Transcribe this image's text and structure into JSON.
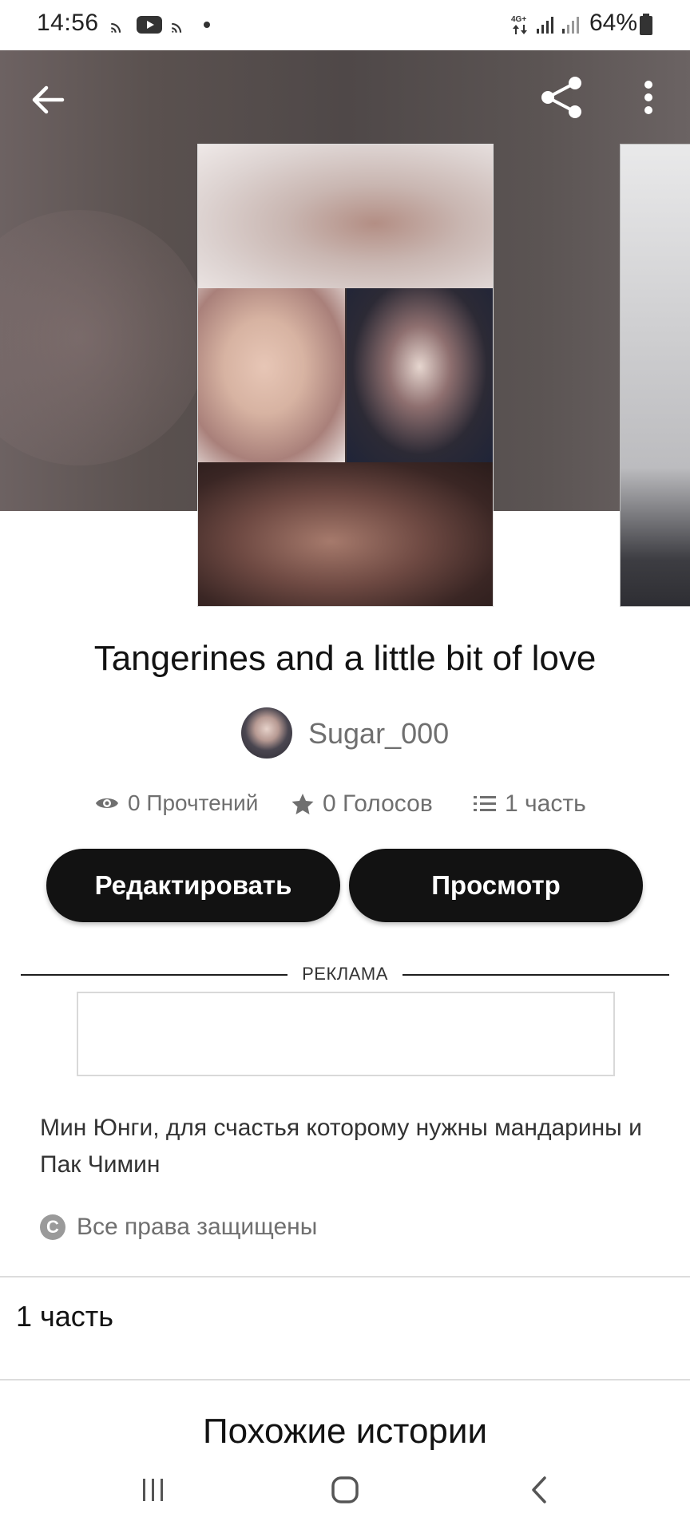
{
  "status_bar": {
    "time": "14:56",
    "battery": "64%",
    "network": "4G+"
  },
  "header": {
    "back_icon": "arrow-left-icon",
    "share_icon": "share-icon",
    "more_icon": "more-vertical-icon"
  },
  "story": {
    "title": "Tangerines and a little bit of love",
    "author": "Sugar_000",
    "stats": {
      "reads": "0 Прочтений",
      "votes": "0 Голосов",
      "parts": "1 часть"
    },
    "description": "Мин Юнги, для счастья которому нужны мандарины и Пак Чимин",
    "copyright": "Все права защищены"
  },
  "actions": {
    "edit_label": "Редактировать",
    "preview_label": "Просмотр"
  },
  "ad": {
    "label": "РЕКЛАМА"
  },
  "parts_list": [
    {
      "label": "1 часть"
    }
  ],
  "similar": {
    "title": "Похожие истории"
  },
  "colors": {
    "primary_button": "#121212",
    "muted_text": "#6f6f6f",
    "divider": "#dcdcdc"
  }
}
